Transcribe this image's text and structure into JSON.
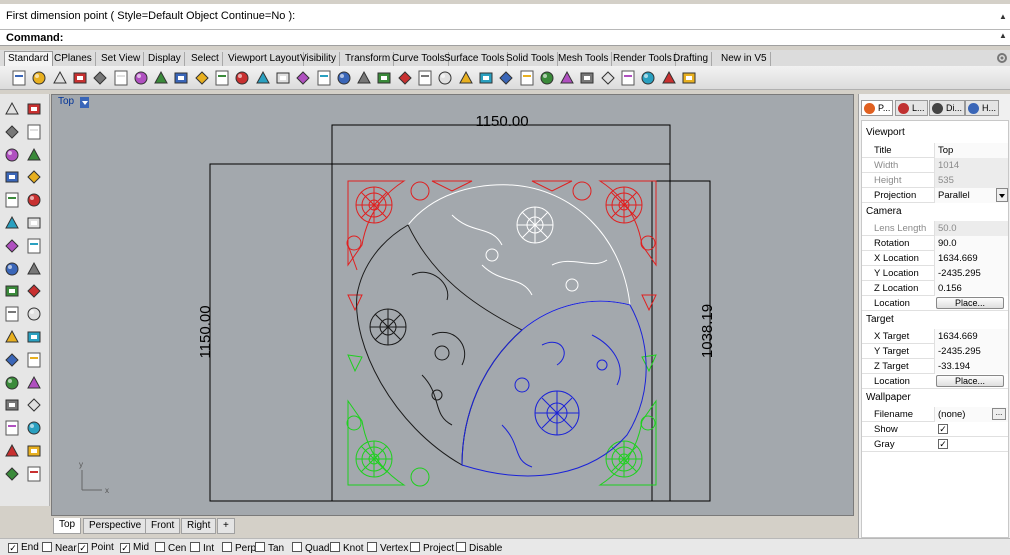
{
  "command": {
    "history": "First dimension point ( Style=Default  Object  Continue=No ):",
    "label": "Command:",
    "value": ""
  },
  "toolbar_tabs": [
    "Standard",
    "CPlanes",
    "Set View",
    "Display",
    "Select",
    "Viewport Layout",
    "Visibility",
    "Transform",
    "Curve Tools",
    "Surface Tools",
    "Solid Tools",
    "Mesh Tools",
    "Render Tools",
    "Drafting",
    "New in V5"
  ],
  "toolbar_icons": [
    "new-icon",
    "open-icon",
    "save-icon",
    "print-icon",
    "import-icon",
    "cut-icon",
    "copy-icon",
    "paste-icon",
    "undo-icon",
    "redo-icon",
    "pan-icon",
    "rotate-view-icon",
    "zoom-icon",
    "zoom-window-icon",
    "zoom-extents-icon",
    "zoom-selected-icon",
    "zoom-target-icon",
    "grid-icon",
    "car-icon",
    "tangent-icon",
    "cplane-icon",
    "dot-icon",
    "light-icon",
    "lock-icon",
    "layer-icon",
    "material-icon",
    "color-circle-icon",
    "render-preview-icon",
    "shaded-sphere-icon",
    "render-icon",
    "pen-icon",
    "options-icon",
    "arrow-tool-icon",
    "help-icon"
  ],
  "left_tools": [
    "select-icon",
    "point-icon",
    "polyline-icon",
    "curve-point-icon",
    "circle-icon",
    "ellipse-icon",
    "arc-icon",
    "rectangle-icon",
    "polygon-icon",
    "freeform-icon",
    "surface-icon",
    "surface-edge-icon",
    "solid-box-icon",
    "solid-sphere-icon",
    "extrude-icon",
    "fillet-icon",
    "mesh-icon",
    "explode-icon",
    "move-icon",
    "split-icon",
    "boolean-icon",
    "group-icon",
    "trim-icon",
    "join-icon",
    "text-icon",
    "dimension-icon",
    "block-icon",
    "hatch-icon",
    "array-icon",
    "analyze-icon",
    "render-box-icon",
    "check-icon",
    "mesh-shape-icon",
    "paint-icon"
  ],
  "viewport": {
    "title": "Top",
    "dims": {
      "top": "1150.00",
      "left": "1150.00",
      "right": "1038.19"
    }
  },
  "viewport_tabs": [
    "Top",
    "Perspective",
    "Front",
    "Right"
  ],
  "osnap": [
    {
      "label": "End",
      "checked": true
    },
    {
      "label": "Near",
      "checked": false
    },
    {
      "label": "Point",
      "checked": true
    },
    {
      "label": "Mid",
      "checked": true
    },
    {
      "label": "Cen",
      "checked": false
    },
    {
      "label": "Int",
      "checked": false
    },
    {
      "label": "Perp",
      "checked": false
    },
    {
      "label": "Tan",
      "checked": false
    },
    {
      "label": "Quad",
      "checked": false
    },
    {
      "label": "Knot",
      "checked": false
    },
    {
      "label": "Vertex",
      "checked": false
    },
    {
      "label": "Project",
      "checked": false
    },
    {
      "label": "Disable",
      "checked": false
    }
  ],
  "panel": {
    "tabs": [
      "P...",
      "L...",
      "Di...",
      "H..."
    ],
    "viewport_section": "Viewport",
    "title_key": "Title",
    "title_val": "Top",
    "width_key": "Width",
    "width_val": "1014",
    "height_key": "Height",
    "height_val": "535",
    "projection_key": "Projection",
    "projection_val": "Parallel",
    "camera_section": "Camera",
    "lens_key": "Lens Length",
    "lens_val": "50.0",
    "rotation_key": "Rotation",
    "rotation_val": "90.0",
    "xloc_key": "X Location",
    "xloc_val": "1634.669",
    "yloc_key": "Y Location",
    "yloc_val": "-2435.295",
    "zloc_key": "Z Location",
    "zloc_val": "0.156",
    "location_key": "Location",
    "place_label": "Place...",
    "target_section": "Target",
    "xt_key": "X Target",
    "xt_val": "1634.669",
    "yt_key": "Y Target",
    "yt_val": "-2435.295",
    "zt_key": "Z Target",
    "zt_val": "-33.194",
    "tlocation_key": "Location",
    "wallpaper_section": "Wallpaper",
    "filename_key": "Filename",
    "filename_val": "(none)",
    "show_key": "Show",
    "gray_key": "Gray"
  },
  "colors": {
    "red": "#e02020",
    "white": "#ffffff",
    "black": "#1a1a1a",
    "blue": "#1a22d8",
    "green": "#1ed01e"
  }
}
